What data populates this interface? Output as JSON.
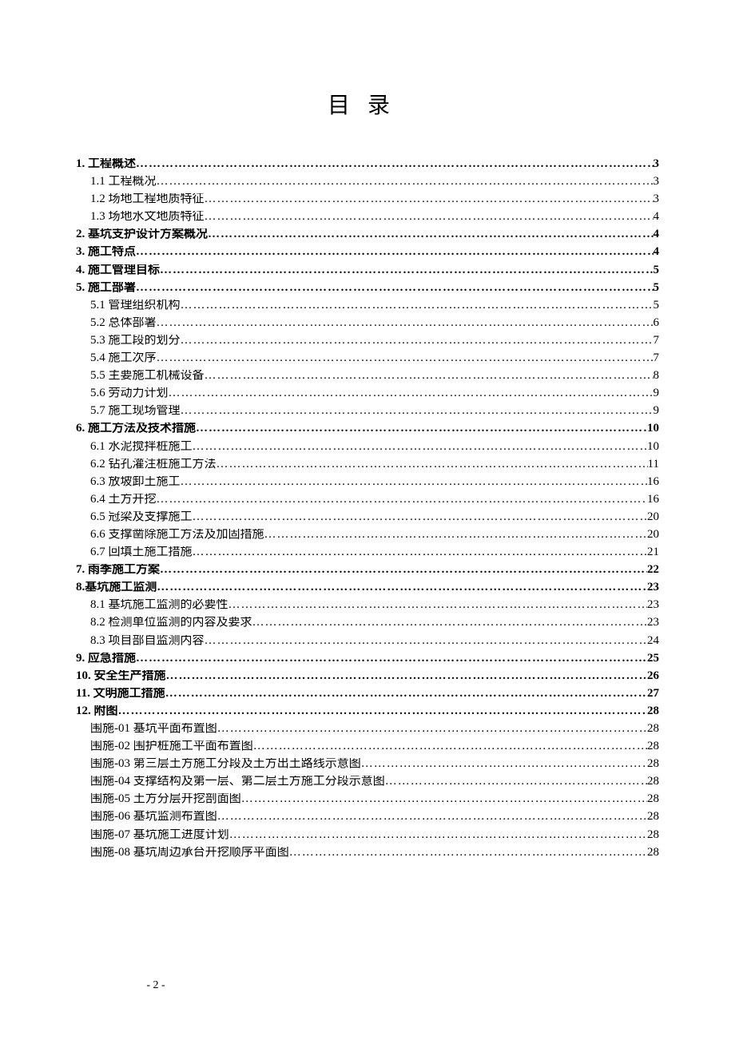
{
  "title": "目录",
  "page_number": "- 2 -",
  "toc": [
    {
      "level": 0,
      "label": "1.  工程概述",
      "page": "3"
    },
    {
      "level": 1,
      "label": "1.1 工程概况",
      "page": "3"
    },
    {
      "level": 1,
      "label": "1.2 场地工程地质特征",
      "page": "3"
    },
    {
      "level": 1,
      "label": "1.3 场地水文地质特征",
      "page": "4"
    },
    {
      "level": 0,
      "label": "2.  基坑支护设计方案概况",
      "page": "4"
    },
    {
      "level": 0,
      "label": "3.  施工特点",
      "page": "4"
    },
    {
      "level": 0,
      "label": "4.  施工管理目标",
      "page": "5"
    },
    {
      "level": 0,
      "label": "5.  施工部署",
      "page": "5"
    },
    {
      "level": 1,
      "label": "5.1 管理组织机构",
      "page": "5"
    },
    {
      "level": 1,
      "label": "5.2 总体部署",
      "page": "6"
    },
    {
      "level": 1,
      "label": "5.3 施工段的划分",
      "page": "7"
    },
    {
      "level": 1,
      "label": "5.4 施工次序",
      "page": "7"
    },
    {
      "level": 1,
      "label": "5.5 主要施工机械设备",
      "page": "8"
    },
    {
      "level": 1,
      "label": "5.6 劳动力计划",
      "page": "9"
    },
    {
      "level": 1,
      "label": "5.7 施工现场管理",
      "page": "9"
    },
    {
      "level": 0,
      "label": "6.  施工方法及技术措施",
      "page": "10"
    },
    {
      "level": 1,
      "label": "6.1 水泥搅拌桩施工",
      "page": "10"
    },
    {
      "level": 1,
      "label": "6.2 钻孔灌注桩施工方法",
      "page": "11"
    },
    {
      "level": 1,
      "label": "6.3 放坡卸土施工",
      "page": "16"
    },
    {
      "level": 1,
      "label": "6.4 土方开挖",
      "page": "16"
    },
    {
      "level": 1,
      "label": "6.5 冠梁及支撑施工",
      "page": "20"
    },
    {
      "level": 1,
      "label": "6.6 支撑凿除施工方法及加固措施",
      "page": "20"
    },
    {
      "level": 1,
      "label": "6.7 回填土施工措施",
      "page": "21"
    },
    {
      "level": 0,
      "label": "7.  雨季施工方案",
      "page": "22"
    },
    {
      "level": 0,
      "label": "8.基坑施工监测",
      "page": "23"
    },
    {
      "level": 1,
      "label": "8.1 基坑施工监测的必要性",
      "page": "23"
    },
    {
      "level": 1,
      "label": "8.2 检测单位监测的内容及要求",
      "page": "23"
    },
    {
      "level": 1,
      "label": "8.3 项目部自监测内容",
      "page": "24"
    },
    {
      "level": 0,
      "label": "9.  应急措施",
      "page": "25"
    },
    {
      "level": 0,
      "label": "10.  安全生产措施",
      "page": "26"
    },
    {
      "level": 0,
      "label": "11.  文明施工措施",
      "page": "27"
    },
    {
      "level": 0,
      "label": "12.  附图",
      "page": "28"
    },
    {
      "level": 1,
      "label": "围施-01 基坑平面布置图",
      "page": "28"
    },
    {
      "level": 1,
      "label": "围施-02 围护桩施工平面布置图",
      "page": "28"
    },
    {
      "level": 1,
      "label": "围施-03 第三层土方施工分段及土方出土路线示意图",
      "page": "28"
    },
    {
      "level": 1,
      "label": "围施-04 支撑结构及第一层、第二层土方施工分段示意图",
      "page": "28"
    },
    {
      "level": 1,
      "label": "围施-05 土方分层开挖剖面图",
      "page": "28"
    },
    {
      "level": 1,
      "label": "围施-06 基坑监测布置图",
      "page": "28"
    },
    {
      "level": 1,
      "label": "围施-07 基坑施工进度计划",
      "page": "28"
    },
    {
      "level": 1,
      "label": "围施-08 基坑周边承台开挖顺序平面图",
      "page": "28"
    }
  ]
}
